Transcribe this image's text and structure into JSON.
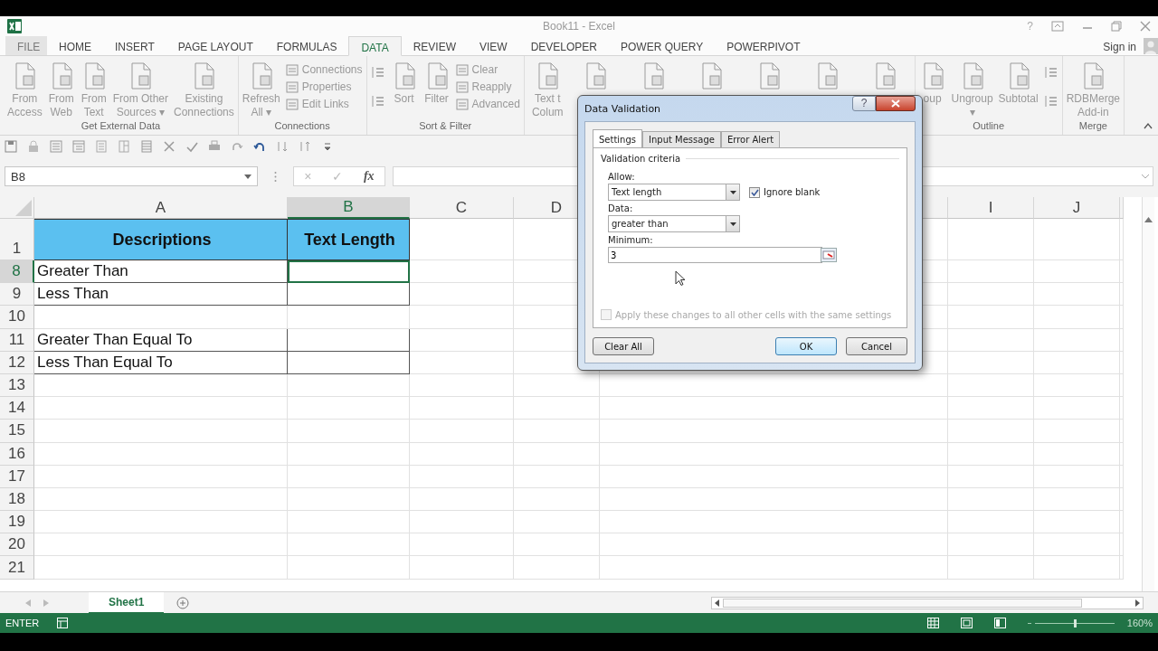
{
  "window": {
    "title": "Book11 - Excel",
    "help": "?",
    "sign_in": "Sign in"
  },
  "ribbon_tabs": [
    {
      "label": "FILE",
      "selected": false,
      "kind": "file"
    },
    {
      "label": "HOME",
      "selected": false,
      "kind": "tab"
    },
    {
      "label": "INSERT",
      "selected": false,
      "kind": "tab"
    },
    {
      "label": "PAGE LAYOUT",
      "selected": false,
      "kind": "tab"
    },
    {
      "label": "FORMULAS",
      "selected": false,
      "kind": "tab"
    },
    {
      "label": "DATA",
      "selected": true,
      "kind": "tab"
    },
    {
      "label": "REVIEW",
      "selected": false,
      "kind": "tab"
    },
    {
      "label": "VIEW",
      "selected": false,
      "kind": "tab"
    },
    {
      "label": "DEVELOPER",
      "selected": false,
      "kind": "tab"
    },
    {
      "label": "POWER QUERY",
      "selected": false,
      "kind": "tab"
    },
    {
      "label": "POWERPIVOT",
      "selected": false,
      "kind": "tab"
    }
  ],
  "ribbon_groups": [
    {
      "label": "Get External Data",
      "items": [
        {
          "kind": "large",
          "lines": [
            "From",
            "Access"
          ]
        },
        {
          "kind": "large",
          "lines": [
            "From",
            "Web"
          ]
        },
        {
          "kind": "large",
          "lines": [
            "From",
            "Text"
          ]
        },
        {
          "kind": "large",
          "lines": [
            "From Other",
            "Sources ▾"
          ]
        },
        {
          "kind": "large",
          "lines": [
            "Existing",
            "Connections"
          ]
        }
      ]
    },
    {
      "label": "Connections",
      "items": [
        {
          "kind": "large",
          "lines": [
            "Refresh",
            "All ▾"
          ]
        },
        {
          "kind": "stack",
          "entries": [
            "Connections",
            "Properties",
            "Edit Links"
          ]
        }
      ]
    },
    {
      "label": "Sort & Filter",
      "items": [
        {
          "kind": "iconpair"
        },
        {
          "kind": "large",
          "lines": [
            "Sort"
          ]
        },
        {
          "kind": "large",
          "lines": [
            "Filter"
          ]
        },
        {
          "kind": "stack",
          "entries": [
            "Clear",
            "Reapply",
            "Advanced"
          ]
        }
      ]
    },
    {
      "items": [
        {
          "kind": "large",
          "lines": [
            "Text t",
            "Colum"
          ]
        },
        {
          "kind": "large"
        },
        {
          "kind": "large"
        },
        {
          "kind": "large"
        },
        {
          "kind": "large"
        },
        {
          "kind": "large"
        },
        {
          "kind": "large"
        }
      ]
    },
    {
      "label": "Outline",
      "items": [
        {
          "kind": "large",
          "lines": [
            "oup"
          ]
        },
        {
          "kind": "large",
          "lines": [
            "Ungroup",
            "▾"
          ]
        },
        {
          "kind": "large",
          "lines": [
            "Subtotal"
          ]
        },
        {
          "kind": "iconpair"
        }
      ]
    },
    {
      "label": "Merge",
      "items": [
        {
          "kind": "large",
          "lines": [
            "RDBMerge",
            "Add-in"
          ]
        }
      ]
    }
  ],
  "name_box": "B8",
  "formula_buttons": [
    "×",
    "✓",
    "fx"
  ],
  "columns": [
    {
      "label": "A",
      "selected": false
    },
    {
      "label": "B",
      "selected": true
    },
    {
      "label": "C",
      "selected": false
    },
    {
      "label": "D",
      "selected": false
    },
    {
      "label": "I",
      "selected": false
    },
    {
      "label": "J",
      "selected": false
    }
  ],
  "rows": [
    {
      "label": "1",
      "kind": "heading",
      "selected": false,
      "cells": [
        {
          "text": "Descriptions",
          "selected": false
        },
        {
          "text": "Text Length",
          "selected": false
        }
      ]
    },
    {
      "label": "8",
      "kind": "bordered",
      "selected": true,
      "cells": [
        {
          "text": "Greater Than",
          "selected": false
        },
        {
          "selected": true
        }
      ]
    },
    {
      "label": "9",
      "kind": "bordered",
      "selected": false,
      "cells": [
        {
          "text": "Less Than",
          "selected": false
        },
        {
          "selected": false
        }
      ]
    },
    {
      "label": "10",
      "kind": "plain",
      "selected": false
    },
    {
      "label": "11",
      "kind": "bordered",
      "selected": false,
      "cells": [
        {
          "text": "Greater Than Equal To",
          "selected": false
        },
        {
          "selected": false
        }
      ]
    },
    {
      "label": "12",
      "kind": "bordered",
      "selected": false,
      "cells": [
        {
          "text": "Less Than Equal To",
          "selected": false
        },
        {
          "selected": false
        }
      ]
    },
    {
      "label": "13",
      "kind": "plain",
      "selected": false
    },
    {
      "label": "14",
      "kind": "plain",
      "selected": false
    },
    {
      "label": "15",
      "kind": "plain",
      "selected": false
    },
    {
      "label": "16",
      "kind": "plain",
      "selected": false
    },
    {
      "label": "17",
      "kind": "plain",
      "selected": false
    },
    {
      "label": "18",
      "kind": "plain",
      "selected": false
    },
    {
      "label": "19",
      "kind": "plain",
      "selected": false
    },
    {
      "label": "20",
      "kind": "plain",
      "selected": false
    },
    {
      "label": "21",
      "kind": "plain",
      "selected": false
    }
  ],
  "sheet_tabs": [
    {
      "label": "Sheet1",
      "selected": true
    }
  ],
  "status_bar": {
    "mode": "ENTER",
    "zoom": {
      "level": 0.5,
      "reading": "160%"
    }
  },
  "dialog": {
    "title": "Data Validation",
    "help": "?",
    "tabs": [
      {
        "label": "Settings",
        "selected": true
      },
      {
        "label": "Input Message",
        "selected": false
      },
      {
        "label": "Error Alert",
        "selected": false
      }
    ],
    "section": "Validation criteria",
    "allow": {
      "label": "Allow:",
      "value": "Text length"
    },
    "ignore_blank": {
      "label": "Ignore blank",
      "checked": true
    },
    "data": {
      "label": "Data:",
      "value": "greater than"
    },
    "minimum": {
      "label": "Minimum:",
      "value": "3"
    },
    "apply_all": {
      "label": "Apply these changes to all other cells with the same settings",
      "checked": false,
      "disabled": true
    },
    "buttons": [
      {
        "label": "Clear All",
        "kind": "secondary"
      },
      {
        "label": "OK",
        "kind": "default"
      },
      {
        "label": "Cancel",
        "kind": "secondary"
      }
    ]
  }
}
